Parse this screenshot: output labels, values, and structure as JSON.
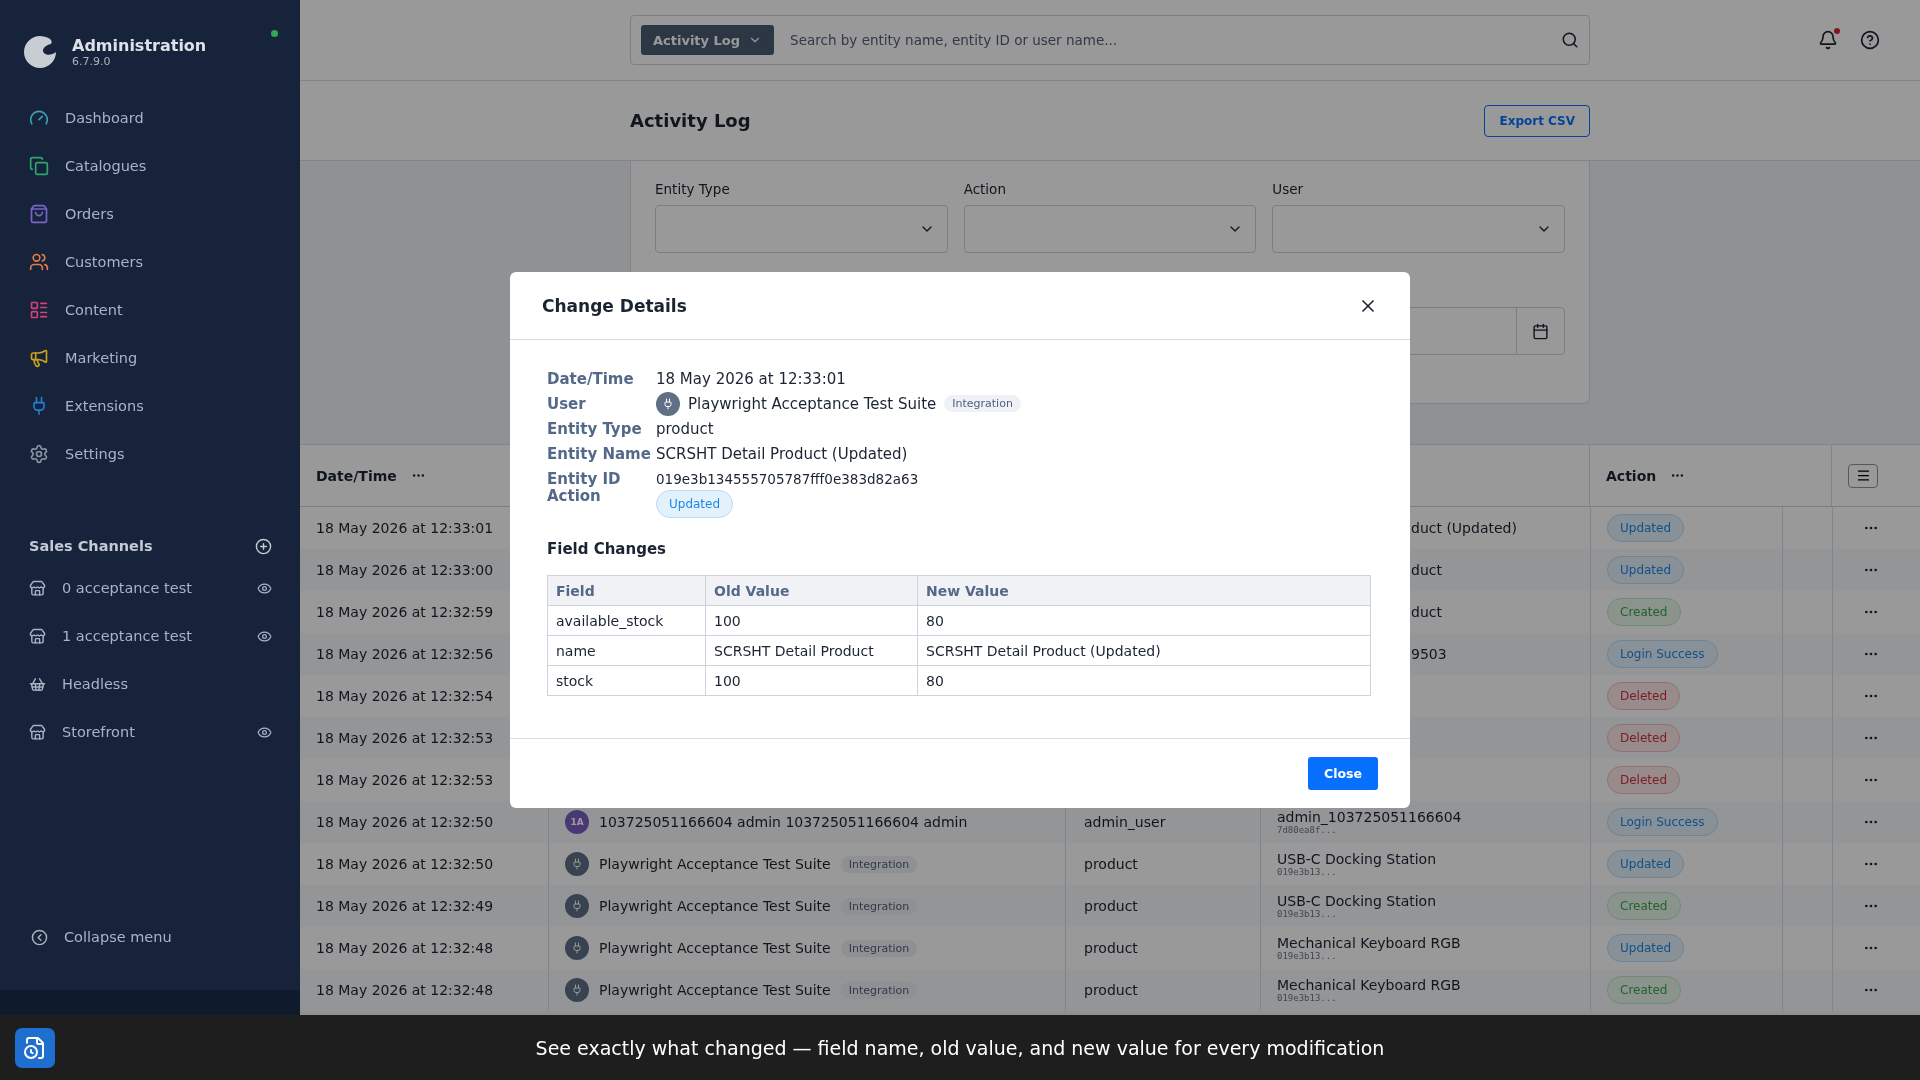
{
  "app": {
    "title": "Administration",
    "version": "6.7.9.0",
    "online": true
  },
  "nav": [
    {
      "label": "Dashboard",
      "color": "#3aa0b4"
    },
    {
      "label": "Catalogues",
      "color": "#2fa56f"
    },
    {
      "label": "Orders",
      "color": "#7b63cc"
    },
    {
      "label": "Customers",
      "color": "#e07b4a"
    },
    {
      "label": "Content",
      "color": "#d0437a"
    },
    {
      "label": "Marketing",
      "color": "#c9a21a"
    },
    {
      "label": "Extensions",
      "color": "#1f7fd0"
    },
    {
      "label": "Settings",
      "color": "#8a94a6"
    }
  ],
  "sales_channels": {
    "title": "Sales Channels",
    "items": [
      {
        "label": "0 acceptance test",
        "visible_toggle": true
      },
      {
        "label": "1 acceptance test",
        "visible_toggle": true
      },
      {
        "label": "Headless",
        "visible_toggle": false
      },
      {
        "label": "Storefront",
        "visible_toggle": true
      }
    ]
  },
  "collapse_menu": "Collapse menu",
  "search": {
    "scope": "Activity Log",
    "placeholder": "Search by entity name, entity ID or user name..."
  },
  "page_title": "Activity Log",
  "export_button": "Export CSV",
  "filters": [
    {
      "label": "Entity Type"
    },
    {
      "label": "Action"
    },
    {
      "label": "User"
    }
  ],
  "table": {
    "columns": [
      {
        "label": "Date/Time"
      },
      {
        "label": "Action"
      }
    ],
    "rows": [
      {
        "time": "18 May 2026 at 12:33:01",
        "entity": "duct (Updated)",
        "action": "Updated",
        "kind": "updated"
      },
      {
        "time": "18 May 2026 at 12:33:00",
        "entity": "duct",
        "action": "Updated",
        "kind": "updated"
      },
      {
        "time": "18 May 2026 at 12:32:59",
        "entity": "duct",
        "action": "Created",
        "kind": "created"
      },
      {
        "time": "18 May 2026 at 12:32:56",
        "entity": "9503",
        "action": "Login Success",
        "kind": "login"
      },
      {
        "time": "18 May 2026 at 12:32:54",
        "action": "Deleted",
        "kind": "deleted"
      },
      {
        "time": "18 May 2026 at 12:32:53",
        "action": "Deleted",
        "kind": "deleted"
      },
      {
        "time": "18 May 2026 at 12:32:53",
        "action": "Deleted",
        "kind": "deleted"
      },
      {
        "time": "18 May 2026 at 12:32:50",
        "user": "103725051166604 admin 103725051166604 admin",
        "initials": "1A",
        "entity_type": "admin_user",
        "entity": "admin_103725051166604",
        "entity_id": "7d80ea8f...",
        "action": "Login Success",
        "kind": "login"
      },
      {
        "time": "18 May 2026 at 12:32:50",
        "user": "Playwright Acceptance Test Suite",
        "tag": "Integration",
        "entity_type": "product",
        "entity": "USB-C Docking Station",
        "entity_id": "019e3b13...",
        "action": "Updated",
        "kind": "updated"
      },
      {
        "time": "18 May 2026 at 12:32:49",
        "user": "Playwright Acceptance Test Suite",
        "tag": "Integration",
        "entity_type": "product",
        "entity": "USB-C Docking Station",
        "entity_id": "019e3b13...",
        "action": "Created",
        "kind": "created"
      },
      {
        "time": "18 May 2026 at 12:32:48",
        "user": "Playwright Acceptance Test Suite",
        "tag": "Integration",
        "entity_type": "product",
        "entity": "Mechanical Keyboard RGB",
        "entity_id": "019e3b13...",
        "action": "Updated",
        "kind": "updated"
      },
      {
        "time": "18 May 2026 at 12:32:48",
        "user": "Playwright Acceptance Test Suite",
        "tag": "Integration",
        "entity_type": "product",
        "entity": "Mechanical Keyboard RGB",
        "entity_id": "019e3b13...",
        "action": "Created",
        "kind": "created"
      }
    ]
  },
  "modal": {
    "title": "Change Details",
    "details": [
      {
        "label": "Date/Time",
        "value": "18 May 2026 at 12:33:01",
        "kind": "text"
      },
      {
        "label": "User",
        "value": "Playwright Acceptance Test Suite",
        "tag": "Integration",
        "kind": "user"
      },
      {
        "label": "Entity Type",
        "value": "product",
        "kind": "text"
      },
      {
        "label": "Entity Name",
        "value": "SCRSHT Detail Product (Updated)",
        "kind": "text"
      },
      {
        "label": "Entity ID",
        "value": "019e3b134555705787fff0e383d82a63",
        "kind": "text"
      },
      {
        "label": "Action",
        "value": "Updated",
        "kind": "badge"
      }
    ],
    "changes_title": "Field Changes",
    "columns": [
      "Field",
      "Old Value",
      "New Value"
    ],
    "changes": [
      [
        "available_stock",
        "100",
        "80"
      ],
      [
        "name",
        "SCRSHT Detail Product",
        "SCRSHT Detail Product (Updated)"
      ],
      [
        "stock",
        "100",
        "80"
      ]
    ],
    "close_button": "Close"
  },
  "caption": "See exactly what changed — field name, old value, and new value for every modification"
}
